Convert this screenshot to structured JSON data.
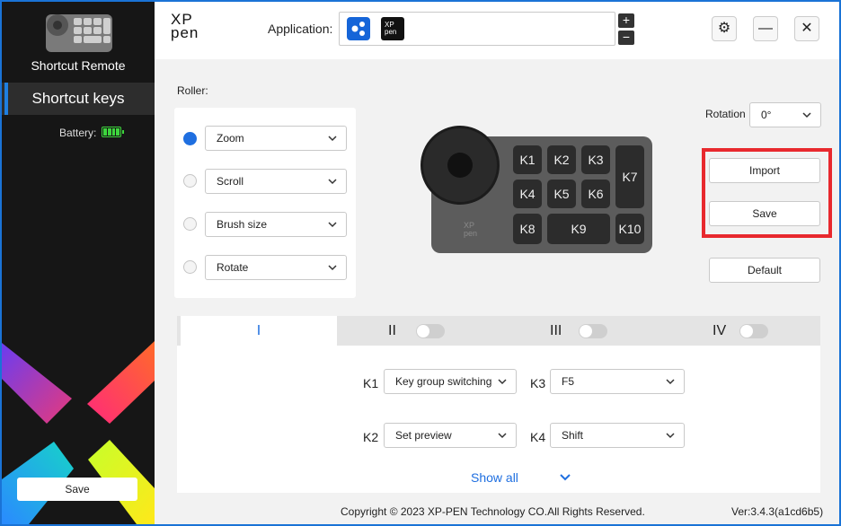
{
  "sidebar": {
    "device_name": "Shortcut Remote",
    "nav_label": "Shortcut keys",
    "battery_label": "Battery:",
    "save_label": "Save"
  },
  "header": {
    "logo_top": "XP",
    "logo_bottom": "pen",
    "app_label": "Application:",
    "app_icon2_text_top": "XP",
    "app_icon2_text_bottom": "pen",
    "plus": "+",
    "minus": "−",
    "settings_glyph": "⚙",
    "minimize_glyph": "—",
    "close_glyph": "✕"
  },
  "roller": {
    "label": "Roller:",
    "options": [
      {
        "label": "Zoom",
        "selected": true
      },
      {
        "label": "Scroll",
        "selected": false
      },
      {
        "label": "Brush size",
        "selected": false
      },
      {
        "label": "Rotate",
        "selected": false
      }
    ]
  },
  "device": {
    "keys": [
      "K1",
      "K2",
      "K3",
      "K7",
      "K4",
      "K5",
      "K6",
      "K8",
      "K9",
      "K10"
    ],
    "brand_top": "XP",
    "brand_bottom": "pen"
  },
  "rotation": {
    "label": "Rotation",
    "value": "0°"
  },
  "actions": {
    "import_label": "Import",
    "save_label": "Save",
    "default_label": "Default"
  },
  "tabs": [
    {
      "label": "I",
      "active": true
    },
    {
      "label": "II",
      "active": false
    },
    {
      "label": "III",
      "active": false
    },
    {
      "label": "IV",
      "active": false
    }
  ],
  "key_settings": [
    {
      "key": "K1",
      "value": "Key group switching"
    },
    {
      "key": "K3",
      "value": "F5"
    },
    {
      "key": "K2",
      "value": "Set preview"
    },
    {
      "key": "K4",
      "value": "Shift"
    }
  ],
  "show_all_label": "Show all",
  "footer": {
    "copyright": "Copyright © 2023  XP-PEN Technology CO.All Rights Reserved.",
    "version": "Ver:3.4.3(a1cd6b5)"
  },
  "colors": {
    "accent": "#1f6fe0",
    "highlight": "#e8292e",
    "sidebar_bg": "#161616"
  }
}
